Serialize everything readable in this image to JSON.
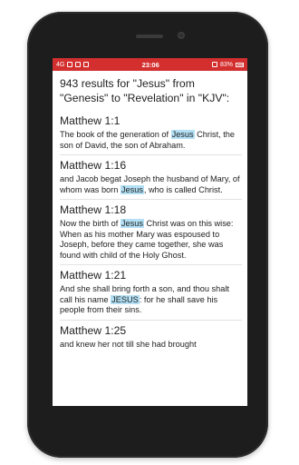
{
  "status_bar": {
    "network": "4G",
    "time": "23:06",
    "battery": "83%"
  },
  "search": {
    "header": "943 results for \"Jesus\" from \"Genesis\" to \"Revelation\" in \"KJV\":"
  },
  "results": [
    {
      "reference": "Matthew 1:1",
      "before": "The book of the generation of ",
      "highlight": "Jesus",
      "after": " Christ, the son of David, the son of Abraham."
    },
    {
      "reference": "Matthew 1:16",
      "before": "and Jacob begat Joseph the husband of Mary, of whom was born ",
      "highlight": "Jesus",
      "after": ", who is called Christ."
    },
    {
      "reference": "Matthew 1:18",
      "before": "Now the birth of ",
      "highlight": "Jesus",
      "after": " Christ was on this wise: When as his mother Mary was espoused to Joseph, before they came together, she was found with child of the Holy Ghost."
    },
    {
      "reference": "Matthew 1:21",
      "before": "And she shall bring forth a son, and thou shalt call his name ",
      "highlight": "JESUS",
      "after": ": for he shall save his people from their sins."
    },
    {
      "reference": "Matthew 1:25",
      "before": "and knew her not till she had brought",
      "highlight": "",
      "after": ""
    }
  ],
  "colors": {
    "status_bar": "#d32f2f",
    "highlight": "#b3e0f5"
  }
}
